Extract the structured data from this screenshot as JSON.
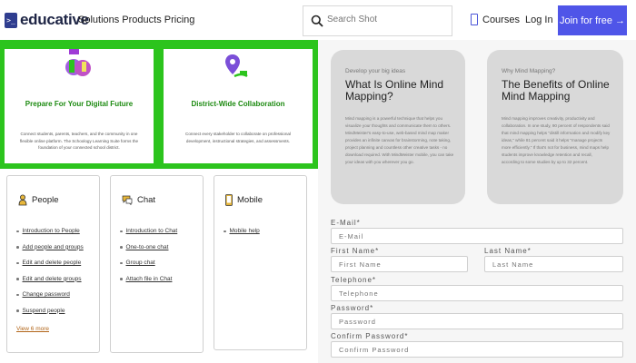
{
  "header": {
    "logo_mark": ">_",
    "logo_text": "educative",
    "nav_text": "Solutions Products Pricing",
    "search_placeholder": "Search Shot",
    "courses_label": "Courses",
    "login_label": "Log In",
    "join_label": "Join for free",
    "join_arrow": "→",
    "accent": "#4f55e8"
  },
  "banner": {
    "color": "#2cc41d",
    "cards": [
      {
        "title": "Prepare For Your Digital Future",
        "description": "Connect students, parents, teachers, and the community in one flexible online platform. The Schoology Learning Suite forms the foundation of your connected school district."
      },
      {
        "title": "District-Wide Collaboration",
        "description": "Connect every stakeholder to collaborate on professional development, instructional strategies, and assessments."
      }
    ]
  },
  "help": {
    "people": {
      "title": "People",
      "links": [
        "Introduction to People",
        "Add people and groups",
        "Edit and delete people",
        "Edit and delete groups",
        "Change password",
        "Suspend people"
      ],
      "view_more": "View 6 more"
    },
    "chat": {
      "title": "Chat",
      "links": [
        "Introduction to Chat",
        "One-to-one chat",
        "Group chat",
        "Attach file in Chat"
      ]
    },
    "mobile": {
      "title": "Mobile",
      "links": [
        "Mobile help"
      ]
    }
  },
  "info_cards": [
    {
      "kicker": "Develop your big ideas",
      "title": "What Is Online Mind Mapping?",
      "body": "Mind mapping is a powerful technique that helps you visualize your thoughts and communicate them to others. MindMeister's easy-to-use, web-based mind map maker provides an infinite canvas for brainstorming, note taking, project planning and countless other creative tasks - no download required. With MindMeister mobile, you can take your ideas with you wherever you go."
    },
    {
      "kicker": "Why Mind Mapping?",
      "title": "The Benefits of Online Mind Mapping",
      "body": "Mind mapping improves creativity, productivity and collaboration. In one study, 90 percent of respondents said that mind mapping helps \"distill information and modify key ideas,\" while 81 percent said it helps \"manage projects more efficiently.\" If that's not for business, mind maps help students improve knowledge retention and recall, according to some studies by up to 32 percent."
    }
  ],
  "form": {
    "email_label": "E-Mail*",
    "email_placeholder": "E-Mail",
    "first_name_label": "First Name*",
    "first_name_placeholder": "First Name",
    "last_name_label": "Last Name*",
    "last_name_placeholder": "Last Name",
    "telephone_label": "Telephone*",
    "telephone_placeholder": "Telephone",
    "password_label": "Password*",
    "password_placeholder": "Password",
    "confirm_label": "Confirm Password*",
    "confirm_placeholder": "Confirm Password"
  }
}
